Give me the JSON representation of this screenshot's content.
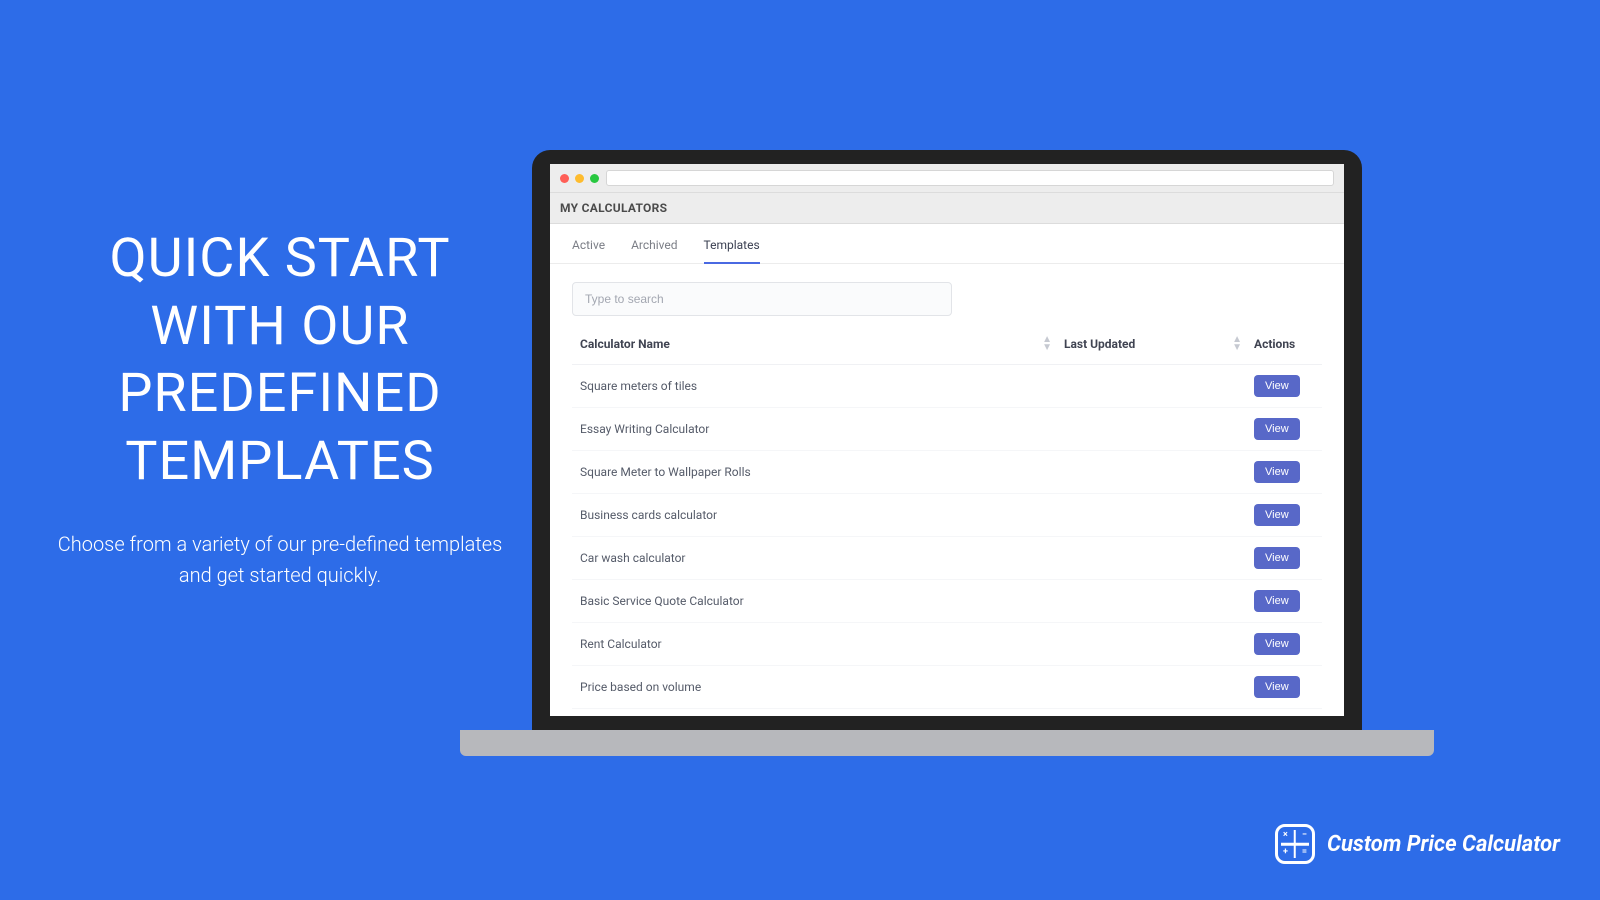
{
  "hero": {
    "title": "QUICK START WITH OUR PREDEFINED TEMPLATES",
    "subtitle": "Choose from a variety of our pre-defined templates and get started quickly."
  },
  "app": {
    "section_title": "MY CALCULATORS",
    "tabs": {
      "active": "Active",
      "archived": "Archived",
      "templates": "Templates"
    },
    "search_placeholder": "Type to search",
    "columns": {
      "name": "Calculator Name",
      "updated": "Last Updated",
      "actions": "Actions"
    },
    "view_label": "View",
    "rows": [
      {
        "name": "Square meters of tiles",
        "updated": ""
      },
      {
        "name": "Essay Writing Calculator",
        "updated": ""
      },
      {
        "name": "Square Meter to Wallpaper Rolls",
        "updated": ""
      },
      {
        "name": "Business cards calculator",
        "updated": ""
      },
      {
        "name": "Car wash calculator",
        "updated": ""
      },
      {
        "name": "Basic Service Quote Calculator",
        "updated": ""
      },
      {
        "name": "Rent Calculator",
        "updated": ""
      },
      {
        "name": "Price based on volume",
        "updated": ""
      }
    ]
  },
  "brand": {
    "name": "Custom Price Calculator"
  }
}
